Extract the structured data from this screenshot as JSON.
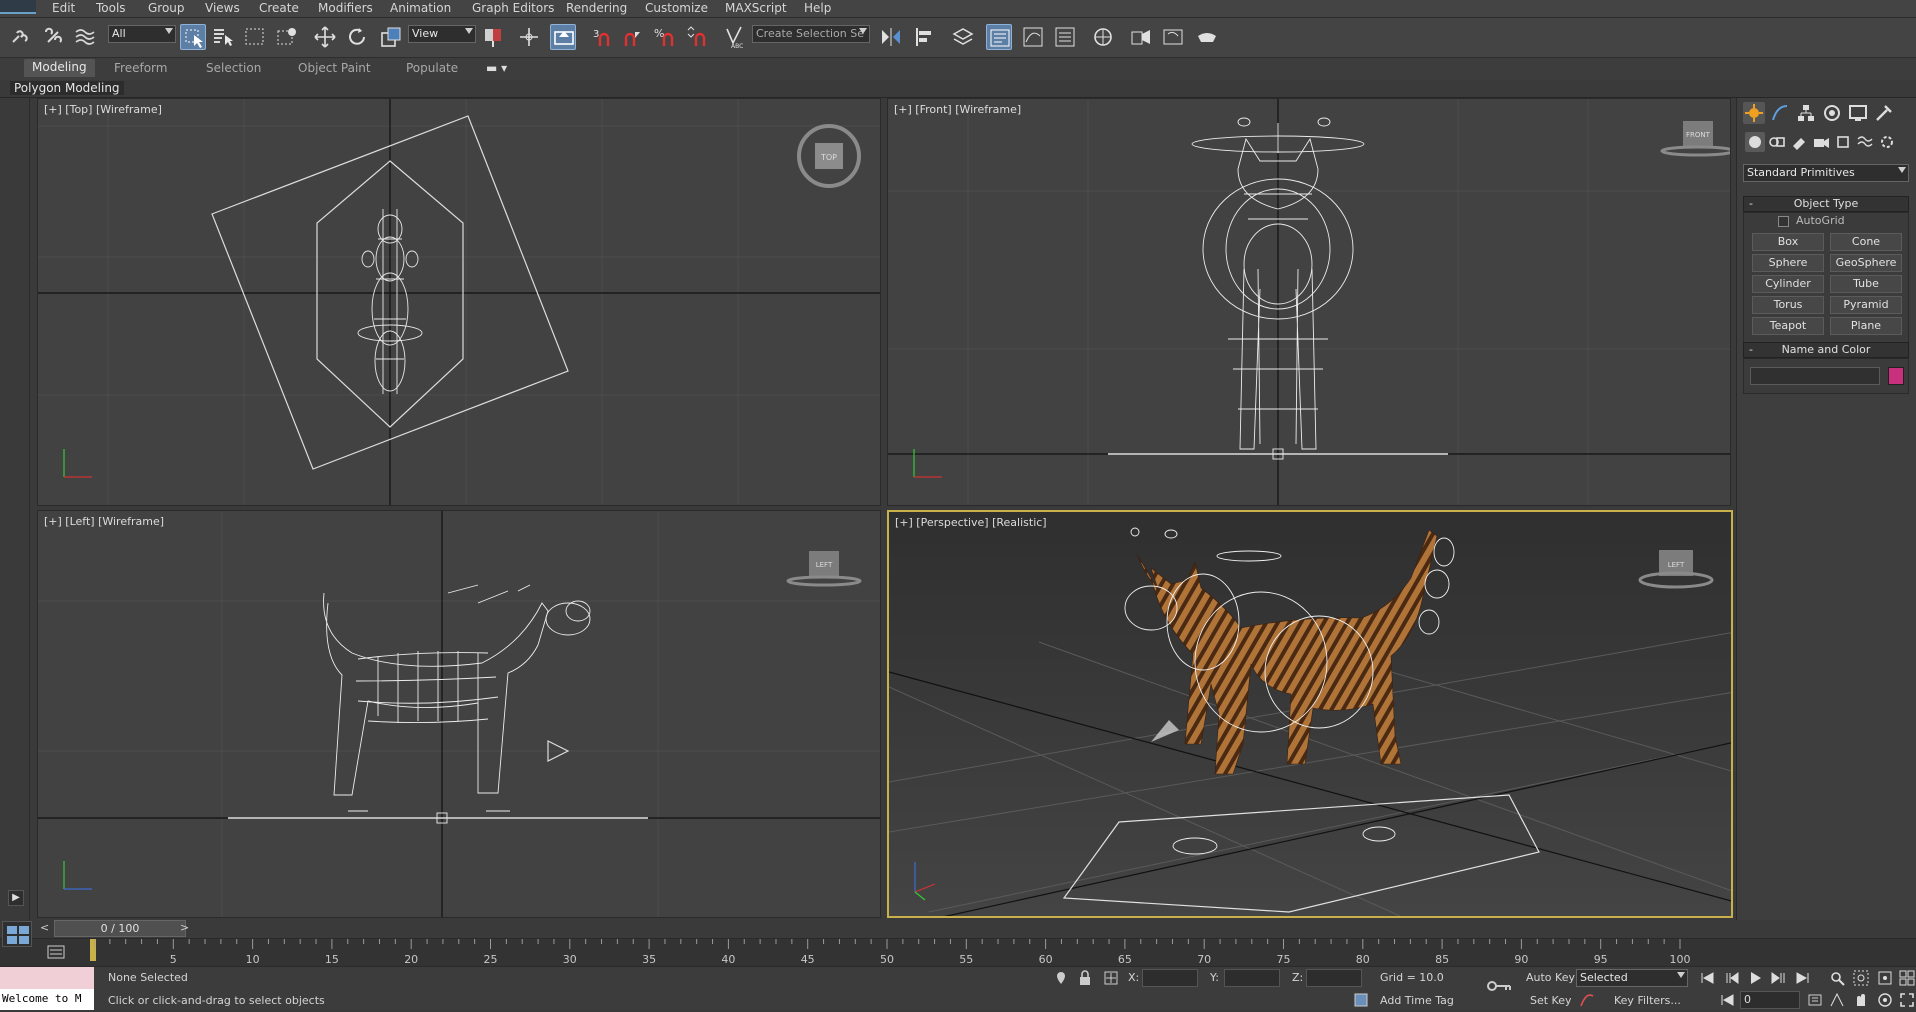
{
  "menu": [
    "Edit",
    "Tools",
    "Group",
    "Views",
    "Create",
    "Modifiers",
    "Animation",
    "Graph Editors",
    "Rendering",
    "Customize",
    "MAXScript",
    "Help"
  ],
  "toolbar": {
    "filter_value": "All",
    "ref_coord_value": "View",
    "selection_set_placeholder": "Create Selection Se"
  },
  "ribbon": {
    "tabs": [
      "Modeling",
      "Freeform",
      "Selection",
      "Object Paint",
      "Populate"
    ],
    "active_tab": "Modeling",
    "panel_label": "Polygon Modeling"
  },
  "viewports": [
    {
      "id": "top",
      "label": "[+] [Top] [Wireframe]",
      "cube_label": "TOP"
    },
    {
      "id": "front",
      "label": "[+] [Front] [Wireframe]",
      "cube_label": "FRONT"
    },
    {
      "id": "left",
      "label": "[+] [Left] [Wireframe]",
      "cube_label": "LEFT"
    },
    {
      "id": "perspective",
      "label": "[+] [Perspective] [Realistic]",
      "cube_label": "LEFT"
    }
  ],
  "command_panel": {
    "category_value": "Standard Primitives",
    "object_type_title": "Object Type",
    "autogrid_label": "AutoGrid",
    "buttons": [
      "Box",
      "Cone",
      "Sphere",
      "GeoSphere",
      "Cylinder",
      "Tube",
      "Torus",
      "Pyramid",
      "Teapot",
      "Plane"
    ],
    "name_color_title": "Name and Color",
    "object_color": "#c8307e"
  },
  "timeline": {
    "frame_display": "0 / 100",
    "ticks": [
      "5",
      "10",
      "15",
      "20",
      "25",
      "30",
      "35",
      "40",
      "45",
      "50",
      "55",
      "60",
      "65",
      "70",
      "75",
      "80",
      "85",
      "90",
      "95",
      "100"
    ]
  },
  "status": {
    "maxscript_listener": "Welcome to M",
    "selection_text": "None Selected",
    "prompt_text": "Click or click-and-drag to select objects",
    "x_label": "X:",
    "y_label": "Y:",
    "z_label": "Z:",
    "grid_text": "Grid = 10.0",
    "add_time_tag": "Add Time Tag",
    "auto_key": "Auto Key",
    "set_key": "Set Key",
    "selected_value": "Selected",
    "key_filters": "Key Filters...",
    "current_frame": "0"
  },
  "colors": {
    "active_viewport_border": "#c8b04a",
    "active_tool": "#5e7fa5"
  }
}
